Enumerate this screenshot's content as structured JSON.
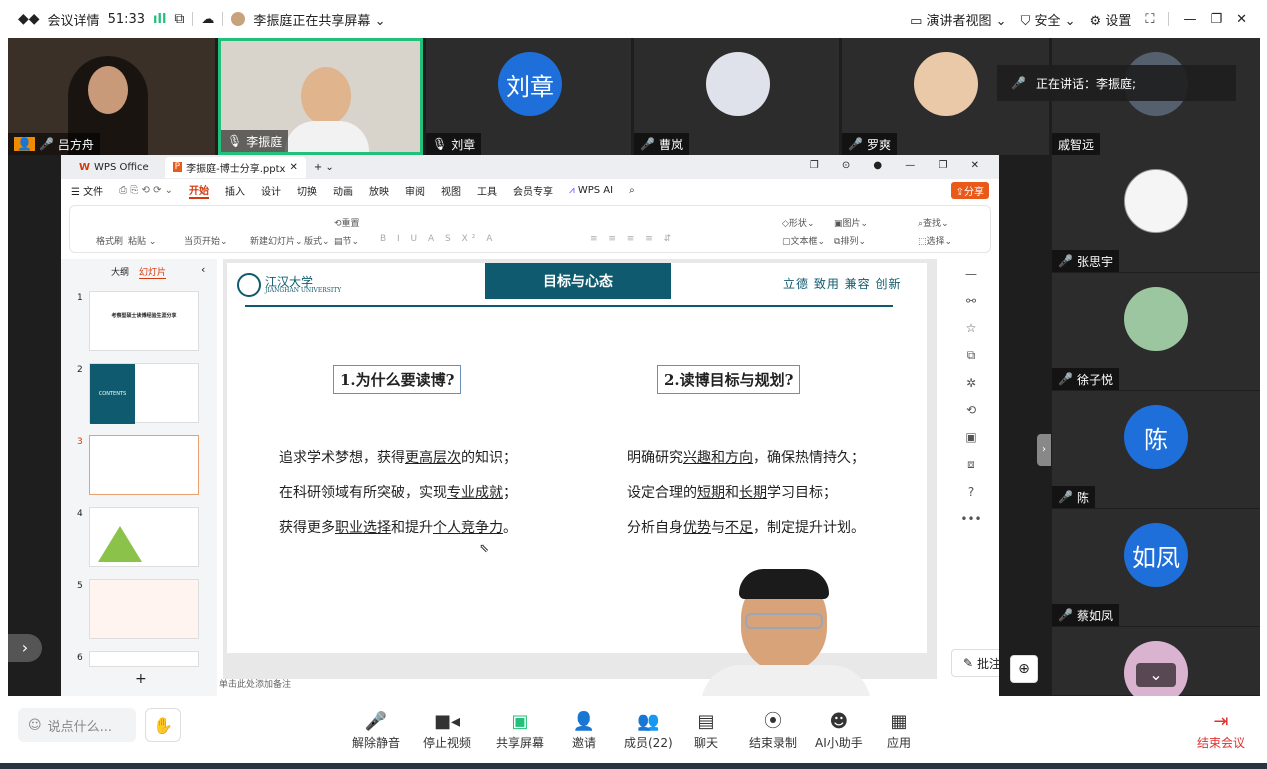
{
  "titlebar": {
    "meeting_details": "会议详情",
    "timer": "51:33",
    "sharing_label": "李振庭正在共享屏幕",
    "presenter_view": "演讲者视图",
    "security": "安全",
    "settings": "设置"
  },
  "participants_top": [
    {
      "name": "吕方舟"
    },
    {
      "name": "李振庭"
    },
    {
      "name": "刘章",
      "avatar_text": "刘章",
      "avatar_color": "#1e6fd9"
    },
    {
      "name": "曹岚"
    },
    {
      "name": "罗爽"
    },
    {
      "name": "戚智远"
    }
  ],
  "speaking_banner": "正在讲话：李振庭;",
  "participants_right": [
    {
      "name": "张思宇"
    },
    {
      "name": "徐子悦"
    },
    {
      "name": "陈",
      "avatar_text": "陈",
      "avatar_color": "#1e6fd9"
    },
    {
      "name": "蔡如凤",
      "avatar_text": "如凤",
      "avatar_color": "#1e6fd9"
    }
  ],
  "wps": {
    "app_tab": "WPS Office",
    "doc_tab": "李振庭-博士分享.pptx",
    "menu": [
      "文件",
      "开始",
      "插入",
      "设计",
      "切换",
      "动画",
      "放映",
      "审阅",
      "视图",
      "工具",
      "会员专享",
      "WPS AI"
    ],
    "share_button": "分享",
    "ribbon": {
      "format_brush": "格式刷",
      "paste": "粘贴",
      "current_start": "当页开始",
      "new_slide": "新建幻灯片",
      "layout": "版式",
      "section": "节",
      "reset": "重置",
      "shape": "形状",
      "image": "图片",
      "textbox": "文本框",
      "arrange": "排列",
      "find": "查找",
      "select": "选择"
    },
    "panel_tabs": {
      "outline": "大纲",
      "slides": "幻灯片"
    },
    "slide_numbers": [
      "1",
      "2",
      "3",
      "4",
      "5",
      "6"
    ],
    "thumb1_title": "考察型硕士读博经验生涯分享",
    "thumb2_label": "CONTENTS",
    "notes_placeholder": "单击此处添加备注",
    "annotate_button": "批注"
  },
  "slide": {
    "university_cn": "江汉大学",
    "university_en": "JIANGHAN UNIVERSITY",
    "title": "目标与心态",
    "motto": "立德 致用 兼容 创新",
    "left_heading": "1.为什么要读博?",
    "right_heading": "2.读博目标与规划?",
    "left_lines": [
      {
        "pre": "追求学术梦想，获得",
        "u": "更高层次",
        "post": "的知识；"
      },
      {
        "pre": "在科研领域有所突破，实现",
        "u": "专业成就",
        "post": "；"
      },
      {
        "pre": "获得更多",
        "u": "职业选择",
        "mid": "和提升",
        "u2": "个人竞争力",
        "post": "。"
      }
    ],
    "right_lines": [
      {
        "pre": "明确研究",
        "u": "兴趣和方向",
        "post": "，确保热情持久；"
      },
      {
        "pre": "设定合理的",
        "u": "短期",
        "mid": "和",
        "u2": "长期",
        "post": "学习目标；"
      },
      {
        "pre": "分析自身",
        "u": "优势",
        "mid": "与",
        "u2": "不足",
        "post": "，制定提升计划。"
      }
    ]
  },
  "bottom": {
    "chat_placeholder": "说点什么...",
    "controls": [
      {
        "label": "解除静音",
        "icon": "mic-muted-icon"
      },
      {
        "label": "停止视频",
        "icon": "camera-icon"
      },
      {
        "label": "共享屏幕",
        "icon": "share-screen-icon"
      },
      {
        "label": "邀请",
        "icon": "invite-icon"
      },
      {
        "label": "成员(22)",
        "icon": "members-icon"
      },
      {
        "label": "聊天",
        "icon": "chat-icon"
      },
      {
        "label": "结束录制",
        "icon": "record-icon"
      },
      {
        "label": "AI小助手",
        "icon": "ai-assistant-icon"
      },
      {
        "label": "应用",
        "icon": "apps-icon"
      }
    ],
    "end_meeting": "结束会议"
  },
  "colors": {
    "accent_blue": "#1e6fd9",
    "slide_title_bg": "#0f5a6e",
    "end_red": "#e03030",
    "active_green": "#22c07a"
  }
}
